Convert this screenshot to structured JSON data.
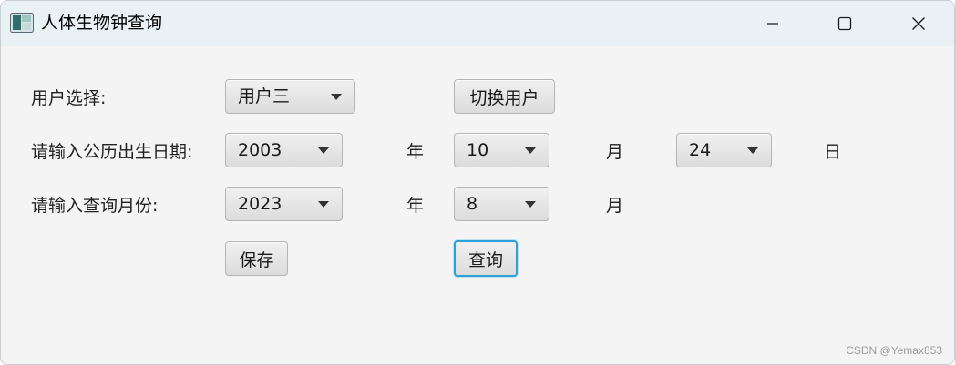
{
  "window": {
    "title": "人体生物钟查询",
    "icons": {
      "app": "app-icon",
      "minimize": "minimize-icon",
      "maximize": "maximize-icon",
      "close": "close-icon"
    }
  },
  "form": {
    "user_label": "用户选择:",
    "user_selected": "用户三",
    "switch_user_button": "切换用户",
    "birth_label": "请输入公历出生日期:",
    "birth_year": "2003",
    "birth_month": "10",
    "birth_day": "24",
    "query_label": "请输入查询月份:",
    "query_year": "2023",
    "query_month": "8",
    "unit_year": "年",
    "unit_month": "月",
    "unit_day": "日",
    "save_button": "保存",
    "query_button": "查询"
  },
  "watermark": "CSDN @Yemax853",
  "colors": {
    "title_bar": "#eaf1f5",
    "background": "#f4f4f4",
    "focus_border": "#2f9fd8"
  }
}
